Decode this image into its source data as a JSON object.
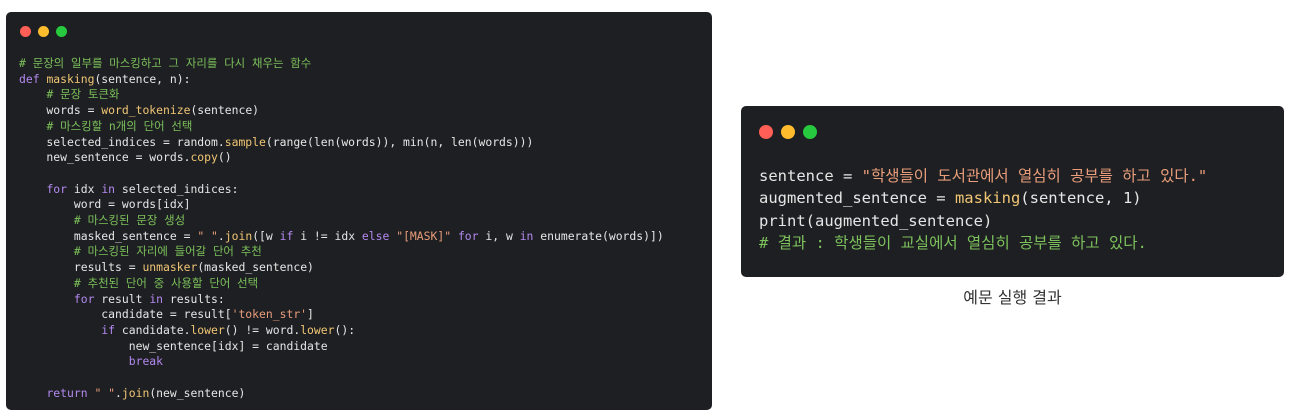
{
  "colors": {
    "window_bg": "#1e1f22",
    "dot_red": "#ff5f56",
    "dot_yellow": "#ffbd2e",
    "dot_green": "#27c93f",
    "keyword": "#b389f0",
    "function": "#f0c674",
    "string": "#e99d7a",
    "comment": "#7cc15b",
    "plain": "#e6e6e6"
  },
  "code_window": {
    "lines": [
      [
        [
          "comment",
          "# 문장의 일부를 마스킹하고 그 자리를 다시 채우는 함수"
        ]
      ],
      [
        [
          "keyword",
          "def "
        ],
        [
          "function",
          "masking"
        ],
        [
          "plain",
          "(sentence, n):"
        ]
      ],
      [
        [
          "plain",
          "    "
        ],
        [
          "comment",
          "# 문장 토큰화"
        ]
      ],
      [
        [
          "plain",
          "    words = "
        ],
        [
          "function",
          "word_tokenize"
        ],
        [
          "plain",
          "(sentence)"
        ]
      ],
      [
        [
          "plain",
          "    "
        ],
        [
          "comment",
          "# 마스킹할 n개의 단어 선택"
        ]
      ],
      [
        [
          "plain",
          "    selected_indices = random."
        ],
        [
          "function",
          "sample"
        ],
        [
          "plain",
          "(range(len(words)), min(n, len(words)))"
        ]
      ],
      [
        [
          "plain",
          "    new_sentence = words."
        ],
        [
          "function",
          "copy"
        ],
        [
          "plain",
          "()"
        ]
      ],
      [
        [
          "plain",
          ""
        ]
      ],
      [
        [
          "plain",
          "    "
        ],
        [
          "keyword",
          "for"
        ],
        [
          "plain",
          " idx "
        ],
        [
          "keyword",
          "in"
        ],
        [
          "plain",
          " selected_indices:"
        ]
      ],
      [
        [
          "plain",
          "        word = words[idx]"
        ]
      ],
      [
        [
          "plain",
          "        "
        ],
        [
          "comment",
          "# 마스킹된 문장 생성"
        ]
      ],
      [
        [
          "plain",
          "        masked_sentence = "
        ],
        [
          "string",
          "\" \""
        ],
        [
          "plain",
          "."
        ],
        [
          "function",
          "join"
        ],
        [
          "plain",
          "([w "
        ],
        [
          "keyword",
          "if"
        ],
        [
          "plain",
          " i != idx "
        ],
        [
          "keyword",
          "else"
        ],
        [
          "plain",
          " "
        ],
        [
          "string",
          "\"[MASK]\""
        ],
        [
          "plain",
          " "
        ],
        [
          "keyword",
          "for"
        ],
        [
          "plain",
          " i, w "
        ],
        [
          "keyword",
          "in"
        ],
        [
          "plain",
          " enumerate(words)])"
        ]
      ],
      [
        [
          "plain",
          "        "
        ],
        [
          "comment",
          "# 마스킹된 자리에 들어갈 단어 추천"
        ]
      ],
      [
        [
          "plain",
          "        results = "
        ],
        [
          "function",
          "unmasker"
        ],
        [
          "plain",
          "(masked_sentence)"
        ]
      ],
      [
        [
          "plain",
          "        "
        ],
        [
          "comment",
          "# 추천된 단어 중 사용할 단어 선택"
        ]
      ],
      [
        [
          "plain",
          "        "
        ],
        [
          "keyword",
          "for"
        ],
        [
          "plain",
          " result "
        ],
        [
          "keyword",
          "in"
        ],
        [
          "plain",
          " results:"
        ]
      ],
      [
        [
          "plain",
          "            candidate = result["
        ],
        [
          "string",
          "'token_str'"
        ],
        [
          "plain",
          "]"
        ]
      ],
      [
        [
          "plain",
          "            "
        ],
        [
          "keyword",
          "if"
        ],
        [
          "plain",
          " candidate."
        ],
        [
          "function",
          "lower"
        ],
        [
          "plain",
          "() != word."
        ],
        [
          "function",
          "lower"
        ],
        [
          "plain",
          "():"
        ]
      ],
      [
        [
          "plain",
          "                new_sentence[idx] = candidate"
        ]
      ],
      [
        [
          "plain",
          "                "
        ],
        [
          "keyword",
          "break"
        ]
      ],
      [
        [
          "plain",
          ""
        ]
      ],
      [
        [
          "plain",
          "    "
        ],
        [
          "keyword",
          "return"
        ],
        [
          "plain",
          " "
        ],
        [
          "string",
          "\" \""
        ],
        [
          "plain",
          "."
        ],
        [
          "function",
          "join"
        ],
        [
          "plain",
          "(new_sentence)"
        ]
      ]
    ]
  },
  "example_window": {
    "lines": [
      [
        [
          "plain",
          "sentence = "
        ],
        [
          "string",
          "\"학생들이 도서관에서 열심히 공부를 하고 있다.\""
        ]
      ],
      [
        [
          "plain",
          "augmented_sentence = "
        ],
        [
          "function",
          "masking"
        ],
        [
          "plain",
          "(sentence, 1)"
        ]
      ],
      [
        [
          "plain",
          "print(augmented_sentence)"
        ]
      ],
      [
        [
          "comment",
          "# 결과 : 학생들이 교실에서 열심히 공부를 하고 있다."
        ]
      ]
    ]
  },
  "caption": "예문 실행 결과"
}
